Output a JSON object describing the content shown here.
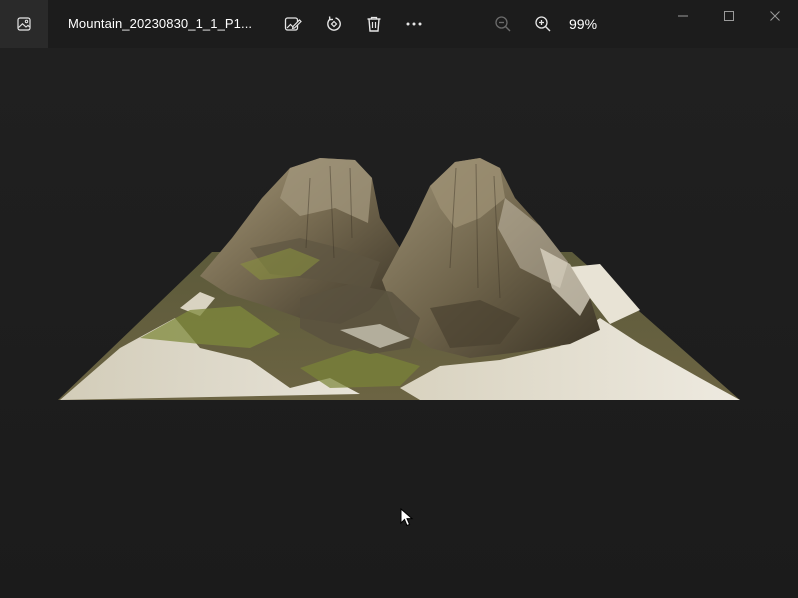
{
  "window": {
    "title": "Mountain_20230830_1_1_P1...",
    "zoom_level": "99%"
  },
  "toolbar": {
    "items": [
      {
        "name": "edit-image",
        "icon": "edit-image-icon"
      },
      {
        "name": "rotate",
        "icon": "rotate-icon"
      },
      {
        "name": "delete",
        "icon": "trash-icon"
      },
      {
        "name": "more",
        "icon": "more-icon"
      }
    ],
    "zoom_out_icon": "zoom-out-icon",
    "zoom_in_icon": "zoom-in-icon"
  },
  "window_controls": {
    "minimize_icon": "minimize-icon",
    "maximize_icon": "maximize-icon",
    "close_icon": "close-icon"
  },
  "image": {
    "subject": "mountain-terrain-render",
    "background_color": "#1c1c1c"
  },
  "colors": {
    "titlebar_text": "#ffffff",
    "icon": "#e6e6e6",
    "icon_disabled": "#6b6b6b",
    "app_icon_bg": "#2a2a2a"
  }
}
